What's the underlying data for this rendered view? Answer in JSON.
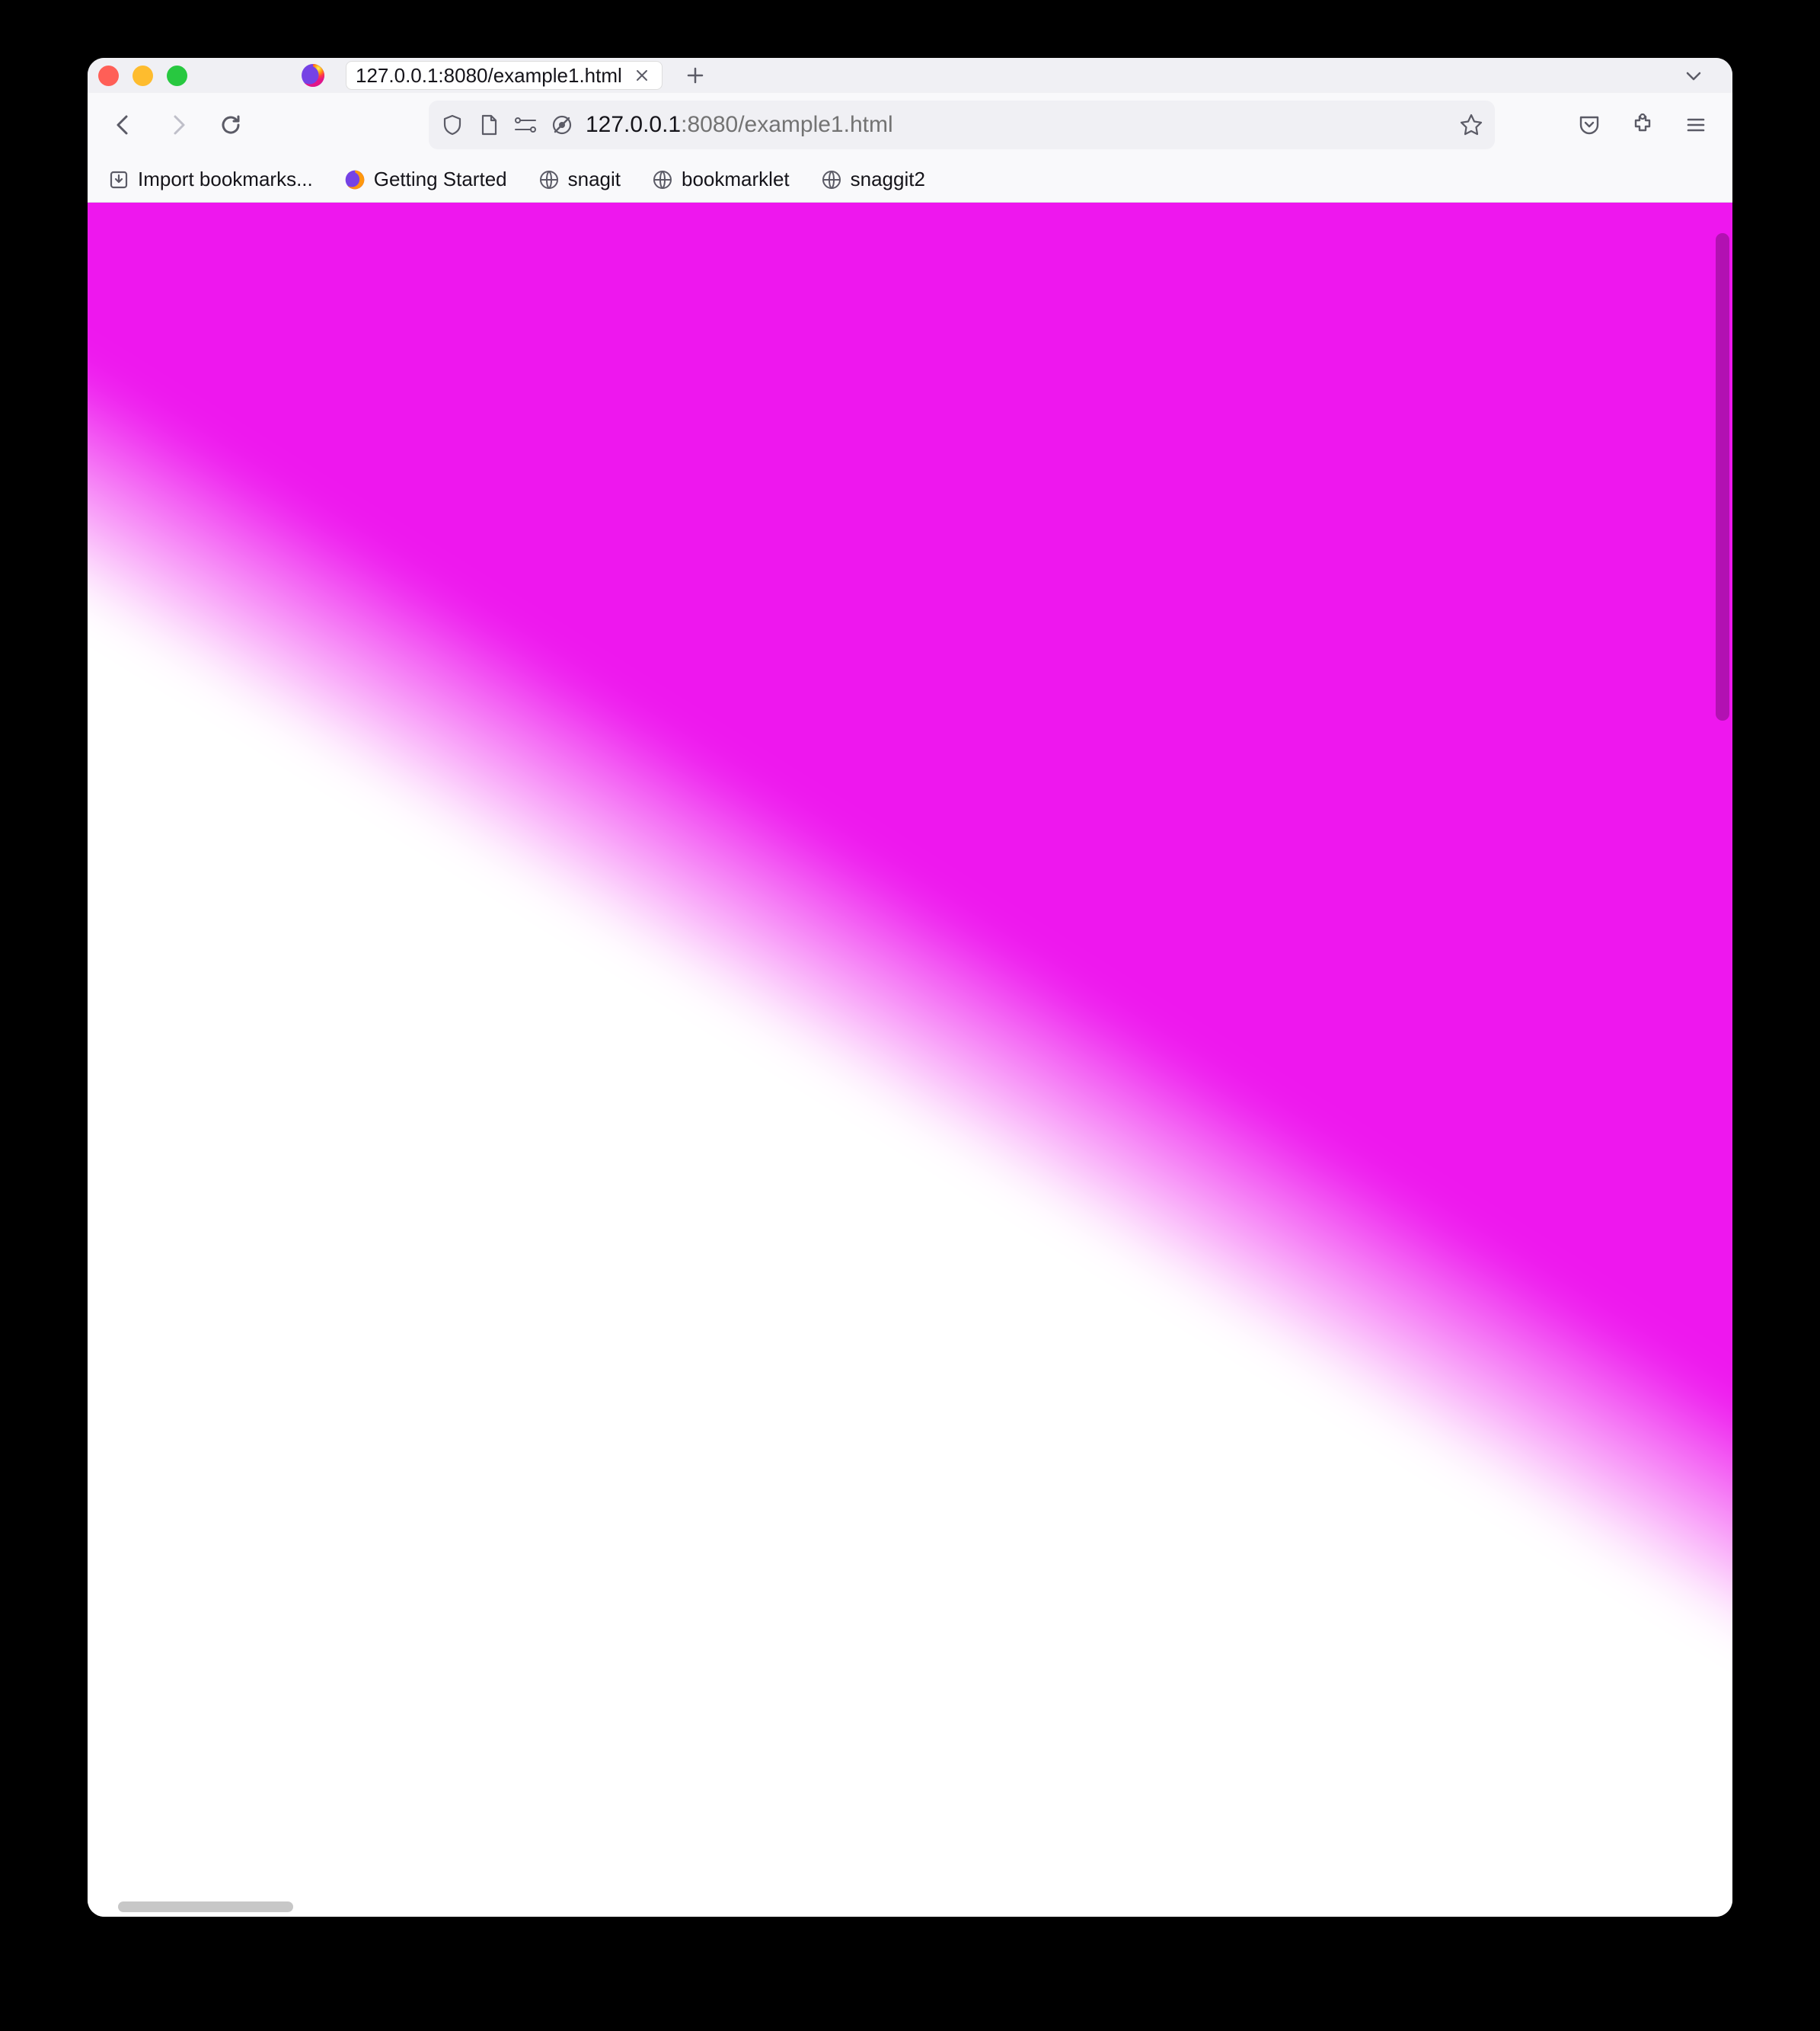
{
  "window": {
    "traffic_lights": [
      "close",
      "minimize",
      "zoom"
    ]
  },
  "tabs": {
    "active": {
      "title": "127.0.0.1:8080/example1.html"
    }
  },
  "urlbar": {
    "host": "127.0.0.1",
    "rest": ":8080/example1.html"
  },
  "bookmarks": [
    {
      "label": "Import bookmarks...",
      "icon": "import"
    },
    {
      "label": "Getting Started",
      "icon": "firefox"
    },
    {
      "label": "snagit",
      "icon": "globe"
    },
    {
      "label": "bookmarklet",
      "icon": "globe"
    },
    {
      "label": "snaggit2",
      "icon": "globe"
    }
  ],
  "page": {
    "gradient_color": "#ee17ee",
    "background_color": "#ffffff"
  }
}
